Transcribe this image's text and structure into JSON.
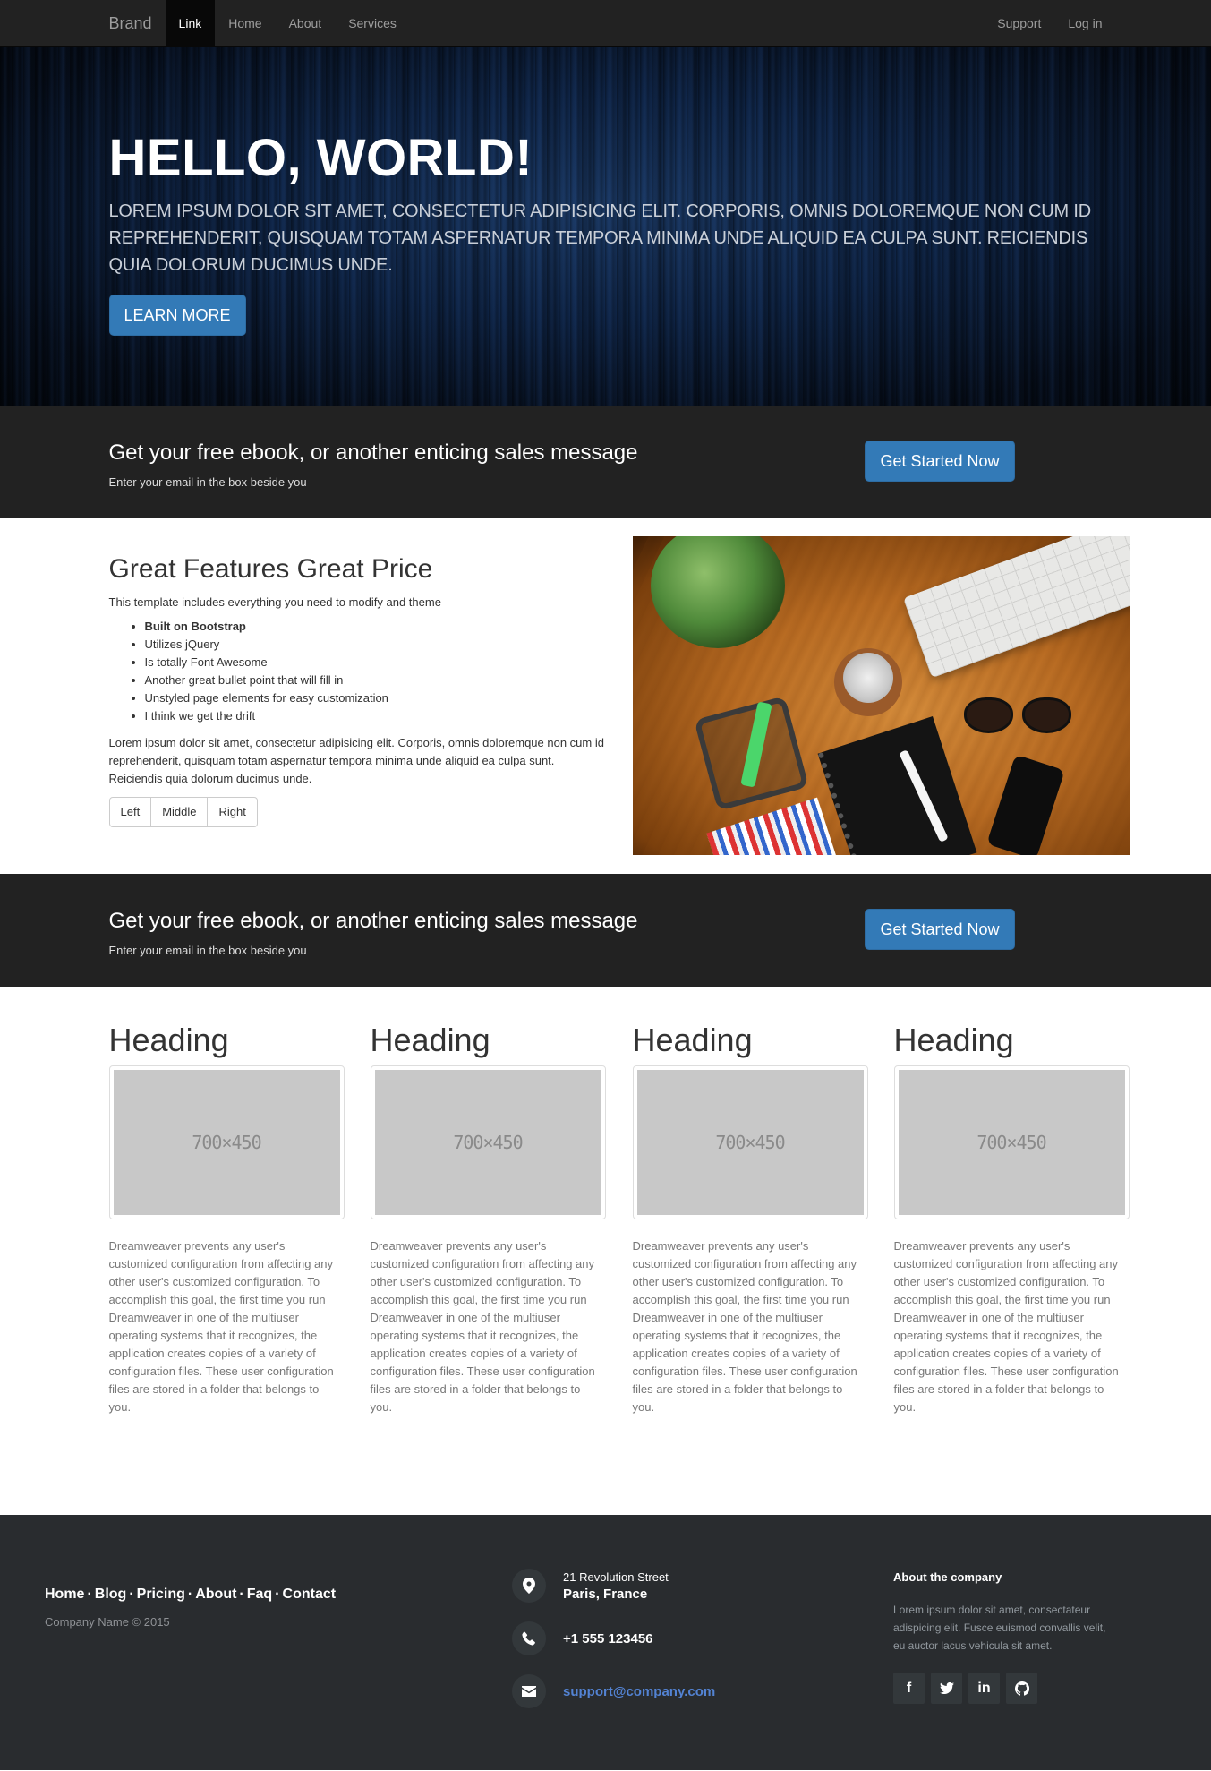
{
  "navbar": {
    "brand": "Brand",
    "left_links": [
      {
        "label": "Link",
        "active": true
      },
      {
        "label": "Home"
      },
      {
        "label": "About"
      },
      {
        "label": "Services"
      }
    ],
    "right_links": [
      {
        "label": "Support"
      },
      {
        "label": "Log in"
      }
    ]
  },
  "hero": {
    "title": "HELLO, WORLD!",
    "text": "Lorem ipsum dolor sit amet, consectetur adipisicing elit. Corporis, omnis doloremque non cum id reprehenderit, quisquam totam aspernatur tempora minima unde aliquid ea culpa sunt. Reiciendis quia dolorum ducimus unde.",
    "button": "LEARN MORE"
  },
  "cta1": {
    "title": "Get your free ebook, or another enticing sales message",
    "subtitle": "Enter your email in the box beside you",
    "button": "Get Started Now"
  },
  "features": {
    "title": "Great Features Great Price",
    "lead": "This template includes everything you need to modify and theme",
    "bullets": [
      "Built on Bootstrap",
      "Utilizes jQuery",
      "Is totally Font Awesome",
      "Another great bullet point that will fill in",
      "Unstyled page elements for easy customization",
      "I think we get the drift"
    ],
    "paragraph": "Lorem ipsum dolor sit amet, consectetur adipisicing elit. Corporis, omnis doloremque non cum id reprehenderit, quisquam totam aspernatur tempora minima unde aliquid ea culpa sunt. Reiciendis quia dolorum ducimus unde.",
    "buttons": [
      "Left",
      "Middle",
      "Right"
    ]
  },
  "cta2": {
    "title": "Get your free ebook, or another enticing sales message",
    "subtitle": "Enter your email in the box beside you",
    "button": "Get Started Now"
  },
  "cards": [
    {
      "heading": "Heading",
      "placeholder": "700×450",
      "text": "Dreamweaver prevents any user's customized configuration from affecting any other user's customized configuration. To accomplish this goal, the first time you run Dreamweaver in one of the multiuser operating systems that it recognizes, the application creates copies of a variety of configuration files. These user configuration files are stored in a folder that belongs to you."
    },
    {
      "heading": "Heading",
      "placeholder": "700×450",
      "text": "Dreamweaver prevents any user's customized configuration from affecting any other user's customized configuration. To accomplish this goal, the first time you run Dreamweaver in one of the multiuser operating systems that it recognizes, the application creates copies of a variety of configuration files. These user configuration files are stored in a folder that belongs to you."
    },
    {
      "heading": "Heading",
      "placeholder": "700×450",
      "text": "Dreamweaver prevents any user's customized configuration from affecting any other user's customized configuration. To accomplish this goal, the first time you run Dreamweaver in one of the multiuser operating systems that it recognizes, the application creates copies of a variety of configuration files. These user configuration files are stored in a folder that belongs to you."
    },
    {
      "heading": "Heading",
      "placeholder": "700×450",
      "text": "Dreamweaver prevents any user's customized configuration from affecting any other user's customized configuration. To accomplish this goal, the first time you run Dreamweaver in one of the multiuser operating systems that it recognizes, the application creates copies of a variety of configuration files. These user configuration files are stored in a folder that belongs to you."
    }
  ],
  "footer": {
    "links": [
      "Home",
      "Blog",
      "Pricing",
      "About",
      "Faq",
      "Contact"
    ],
    "separator": "·",
    "company": "Company Name © 2015",
    "address_line1": "21 Revolution Street",
    "address_line2": "Paris, France",
    "phone": "+1 555 123456",
    "email": "support@company.com",
    "about_title": "About the company",
    "about_text": "Lorem ipsum dolor sit amet, consectateur adispicing elit. Fusce euismod convallis velit, eu auctor lacus vehicula sit amet.",
    "social": [
      "facebook-icon",
      "twitter-icon",
      "linkedin-icon",
      "github-icon"
    ]
  }
}
